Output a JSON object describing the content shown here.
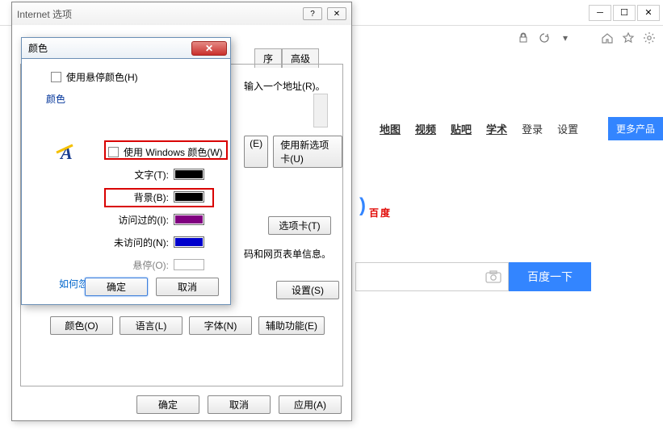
{
  "browser": {
    "lock_refresh_down": "▾"
  },
  "baidu": {
    "nav": [
      "地图",
      "视频",
      "贴吧",
      "学术",
      "登录",
      "设置"
    ],
    "more": "更多产品",
    "logo": "百度",
    "search_btn": "百度一下"
  },
  "io": {
    "title": "Internet 选项",
    "tabs": [
      "序",
      "高级"
    ],
    "addr_hint": "输入一个地址(R)。",
    "btns_row1": [
      "(E)",
      "使用新选项卡(U)"
    ],
    "tabcard": "选项卡(T)",
    "html5_hint": "码和网页表单信息。",
    "settings": "设置(S)",
    "bottom_btns": [
      "颜色(O)",
      "语言(L)",
      "字体(N)",
      "辅助功能(E)"
    ],
    "footer": [
      "确定",
      "取消",
      "应用(A)"
    ]
  },
  "cd": {
    "title": "颜色",
    "hover_check": "使用悬停颜色(H)",
    "group": "颜色",
    "win_check": "使用 Windows 颜色(W)",
    "rows": [
      {
        "label": "文字(T):",
        "color": "#000000"
      },
      {
        "label": "背景(B):",
        "color": "#000000"
      },
      {
        "label": "访问过的(I):",
        "color": "#800080"
      },
      {
        "label": "未访问的(N):",
        "color": "#0000cc"
      },
      {
        "label": "悬停(O):",
        "color": "#ffffff",
        "disabled": true
      }
    ],
    "link": "如何忽略预设颜色",
    "ok": "确定",
    "cancel": "取消"
  }
}
